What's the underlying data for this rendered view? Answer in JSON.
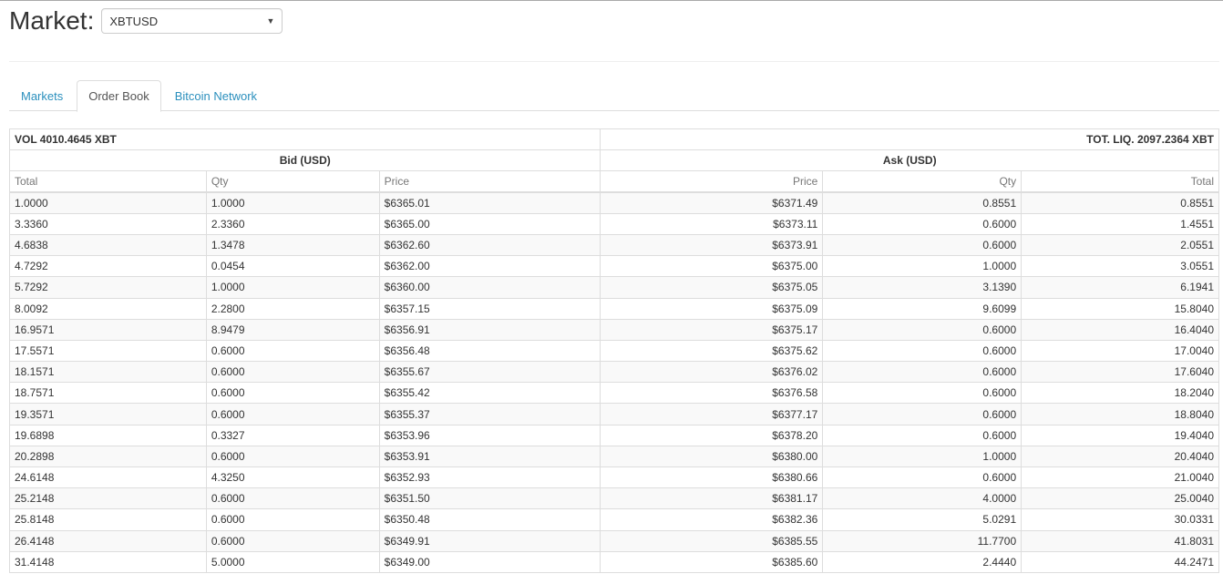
{
  "header": {
    "label": "Market:",
    "selected_market": "XBTUSD"
  },
  "tabs": [
    {
      "label": "Markets",
      "active": false
    },
    {
      "label": "Order Book",
      "active": true
    },
    {
      "label": "Bitcoin Network",
      "active": false
    }
  ],
  "orderbook": {
    "volume": "VOL 4010.4645 XBT",
    "liquidity": "TOT. LIQ. 2097.2364 XBT",
    "bid_title": "Bid (USD)",
    "ask_title": "Ask (USD)",
    "bid_columns": [
      "Total",
      "Qty",
      "Price"
    ],
    "ask_columns": [
      "Price",
      "Qty",
      "Total"
    ],
    "rows": [
      {
        "bid": [
          "1.0000",
          "1.0000",
          "$6365.01"
        ],
        "ask": [
          "$6371.49",
          "0.8551",
          "0.8551"
        ]
      },
      {
        "bid": [
          "3.3360",
          "2.3360",
          "$6365.00"
        ],
        "ask": [
          "$6373.11",
          "0.6000",
          "1.4551"
        ]
      },
      {
        "bid": [
          "4.6838",
          "1.3478",
          "$6362.60"
        ],
        "ask": [
          "$6373.91",
          "0.6000",
          "2.0551"
        ]
      },
      {
        "bid": [
          "4.7292",
          "0.0454",
          "$6362.00"
        ],
        "ask": [
          "$6375.00",
          "1.0000",
          "3.0551"
        ]
      },
      {
        "bid": [
          "5.7292",
          "1.0000",
          "$6360.00"
        ],
        "ask": [
          "$6375.05",
          "3.1390",
          "6.1941"
        ]
      },
      {
        "bid": [
          "8.0092",
          "2.2800",
          "$6357.15"
        ],
        "ask": [
          "$6375.09",
          "9.6099",
          "15.8040"
        ]
      },
      {
        "bid": [
          "16.9571",
          "8.9479",
          "$6356.91"
        ],
        "ask": [
          "$6375.17",
          "0.6000",
          "16.4040"
        ]
      },
      {
        "bid": [
          "17.5571",
          "0.6000",
          "$6356.48"
        ],
        "ask": [
          "$6375.62",
          "0.6000",
          "17.0040"
        ]
      },
      {
        "bid": [
          "18.1571",
          "0.6000",
          "$6355.67"
        ],
        "ask": [
          "$6376.02",
          "0.6000",
          "17.6040"
        ]
      },
      {
        "bid": [
          "18.7571",
          "0.6000",
          "$6355.42"
        ],
        "ask": [
          "$6376.58",
          "0.6000",
          "18.2040"
        ]
      },
      {
        "bid": [
          "19.3571",
          "0.6000",
          "$6355.37"
        ],
        "ask": [
          "$6377.17",
          "0.6000",
          "18.8040"
        ]
      },
      {
        "bid": [
          "19.6898",
          "0.3327",
          "$6353.96"
        ],
        "ask": [
          "$6378.20",
          "0.6000",
          "19.4040"
        ]
      },
      {
        "bid": [
          "20.2898",
          "0.6000",
          "$6353.91"
        ],
        "ask": [
          "$6380.00",
          "1.0000",
          "20.4040"
        ]
      },
      {
        "bid": [
          "24.6148",
          "4.3250",
          "$6352.93"
        ],
        "ask": [
          "$6380.66",
          "0.6000",
          "21.0040"
        ]
      },
      {
        "bid": [
          "25.2148",
          "0.6000",
          "$6351.50"
        ],
        "ask": [
          "$6381.17",
          "4.0000",
          "25.0040"
        ]
      },
      {
        "bid": [
          "25.8148",
          "0.6000",
          "$6350.48"
        ],
        "ask": [
          "$6382.36",
          "5.0291",
          "30.0331"
        ]
      },
      {
        "bid": [
          "26.4148",
          "0.6000",
          "$6349.91"
        ],
        "ask": [
          "$6385.55",
          "11.7700",
          "41.8031"
        ]
      },
      {
        "bid": [
          "31.4148",
          "5.0000",
          "$6349.00"
        ],
        "ask": [
          "$6385.60",
          "2.4440",
          "44.2471"
        ]
      }
    ]
  }
}
